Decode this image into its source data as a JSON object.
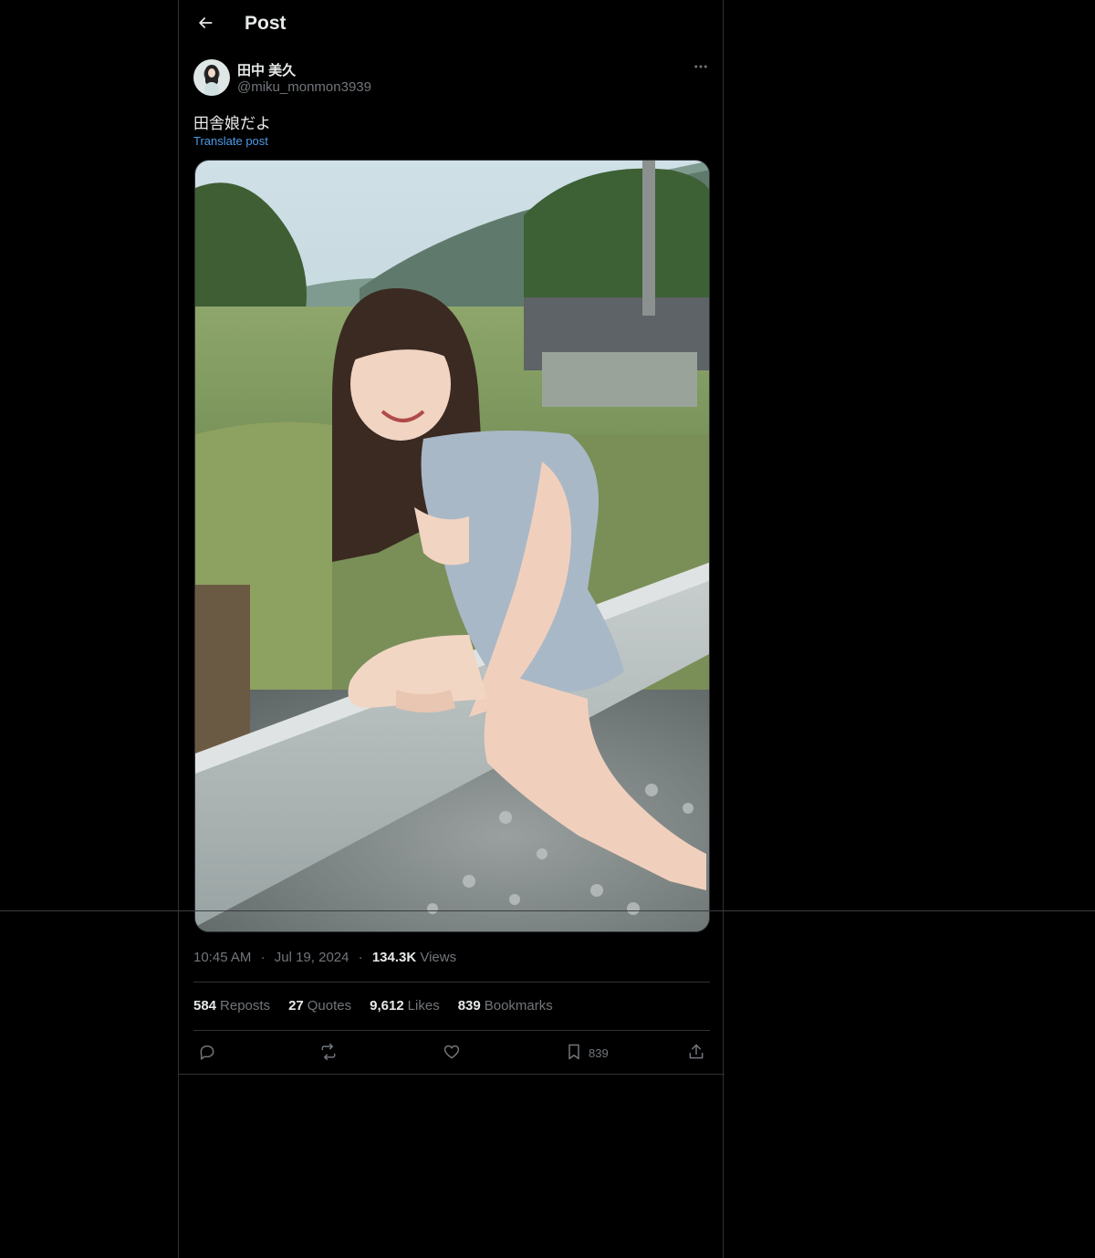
{
  "header": {
    "title": "Post"
  },
  "author": {
    "name": "田中 美久",
    "handle": "@miku_monmon3939"
  },
  "post": {
    "text": "田舎娘だよ",
    "translate_label": "Translate post",
    "media_alt": "Photo of a smiling woman sitting on a wooden rail in the countryside"
  },
  "meta": {
    "time": "10:45 AM",
    "dot1": "·",
    "date": "Jul 19, 2024",
    "dot2": "·",
    "views_count": "134.3K",
    "views_label": "Views"
  },
  "stats": {
    "reposts_count": "584",
    "reposts_label": "Reposts",
    "quotes_count": "27",
    "quotes_label": "Quotes",
    "likes_count": "9,612",
    "likes_label": "Likes",
    "bookmarks_count": "839",
    "bookmarks_label": "Bookmarks"
  },
  "actions": {
    "bookmark_count": "839"
  },
  "icons": [
    "back-arrow-icon",
    "more-icon",
    "reply-icon",
    "repost-icon",
    "like-icon",
    "bookmark-icon",
    "share-icon"
  ],
  "colors": {
    "background": "#000000",
    "text": "#e7e9ea",
    "muted": "#71767b",
    "link": "#4d9be6",
    "border": "#2f3336"
  }
}
